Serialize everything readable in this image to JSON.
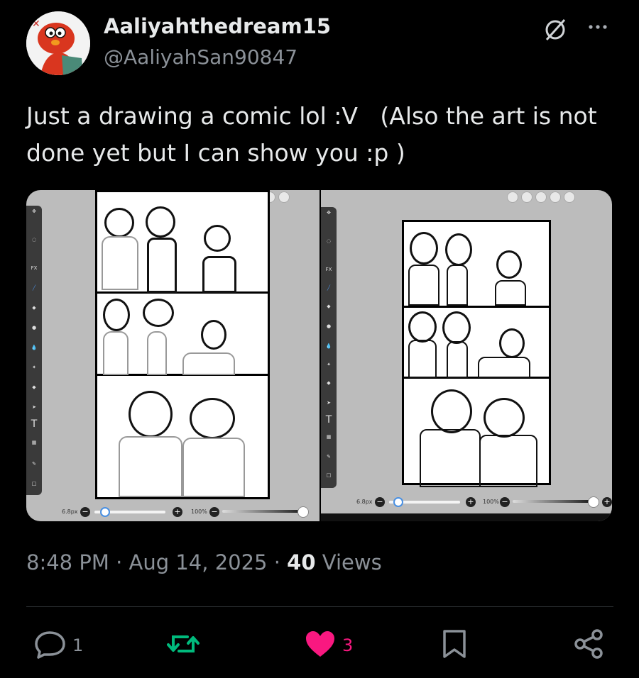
{
  "author": {
    "display_name": "Aaliyahthedream15",
    "handle": "@AaliyahSan90847"
  },
  "tweet": {
    "text": "Just a drawing a comic lol :V   (Also the art is not done yet but I can show you :p )"
  },
  "media": {
    "left_app": {
      "tools": [
        "Transform",
        "Magic Wand",
        "Lasso",
        "Filter",
        "Brush",
        "Eraser",
        "Smudge",
        "Blur",
        "Special",
        "Bucket",
        "Vector",
        "Text",
        "Frame Divider",
        "Eyedropper",
        "Canvas"
      ],
      "brush_size": "6.8px",
      "opacity": "100%"
    },
    "right_app": {
      "tools": [
        "Transform",
        "Magic Wand",
        "Lasso",
        "Filter",
        "Brush",
        "Eraser",
        "Smudge",
        "Blur",
        "Special",
        "Bucket",
        "Vector",
        "Text",
        "Frame Divider",
        "Eyedropper",
        "Canvas"
      ],
      "brush_size": "6.8px",
      "opacity": "100%"
    }
  },
  "meta": {
    "time": "8:48 PM",
    "separator": "·",
    "date": "Aug 14, 2025",
    "views": "40",
    "views_label": "Views"
  },
  "actions": {
    "replies": "1",
    "reposts": "",
    "likes": "3"
  },
  "colors": {
    "background": "#000000",
    "text": "#e7e9ea",
    "muted": "#8b9198",
    "repost_green": "#00ba7c",
    "like_pink": "#f91880"
  },
  "icons": [
    "grok-icon",
    "more-icon",
    "reply-icon",
    "repost-icon",
    "like-icon",
    "bookmark-icon",
    "share-icon"
  ]
}
